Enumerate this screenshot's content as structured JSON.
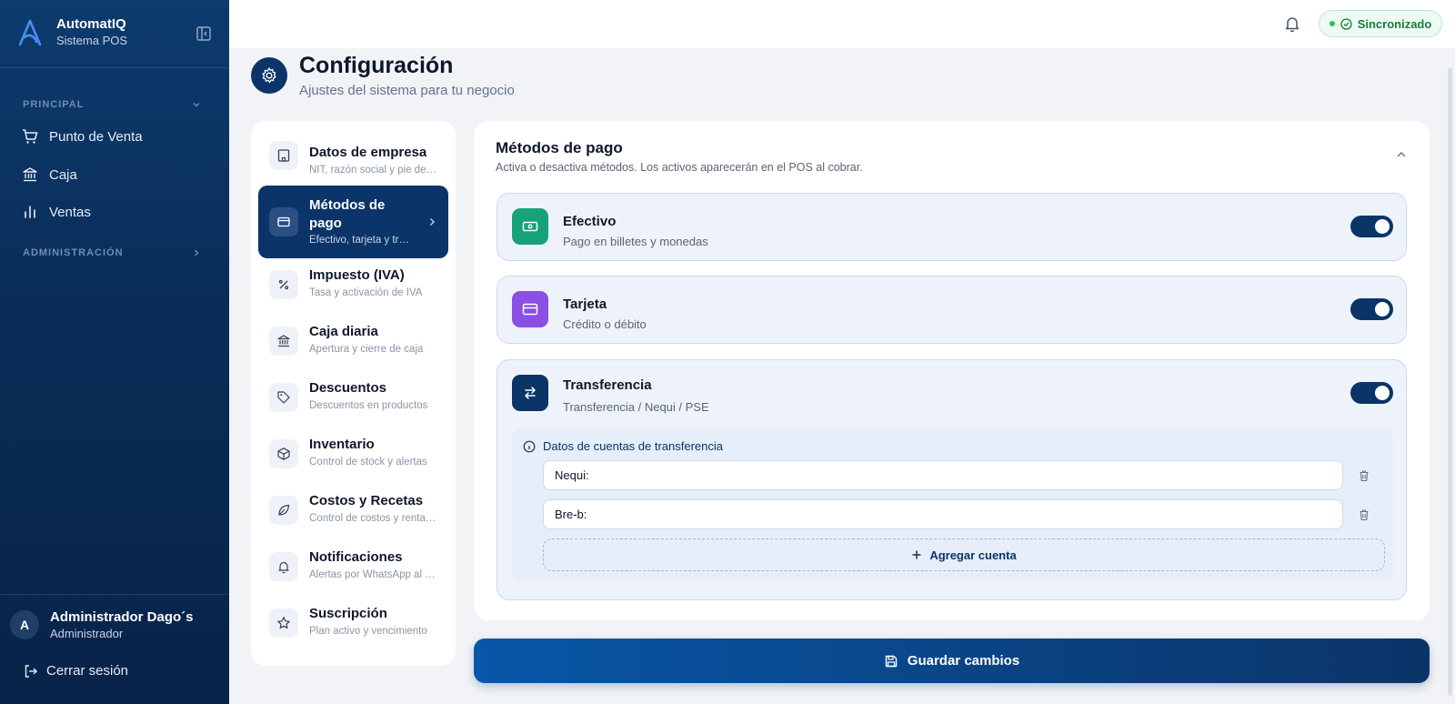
{
  "brand": {
    "name": "AutomatIQ",
    "subtitle": "Sistema POS"
  },
  "sidebar": {
    "sections": [
      {
        "label": "PRINCIPAL",
        "items": [
          {
            "label": "Punto de Venta",
            "icon": "cart-icon"
          },
          {
            "label": "Caja",
            "icon": "bank-icon"
          },
          {
            "label": "Ventas",
            "icon": "bar-chart-icon"
          }
        ]
      },
      {
        "label": "ADMINISTRACIÓN",
        "items": []
      }
    ],
    "user": {
      "initial": "A",
      "name": "Administrador Dago´s",
      "role": "Administrador"
    },
    "logout_label": "Cerrar sesión"
  },
  "topbar": {
    "status": "Sincronizado",
    "status_color": "#15803d"
  },
  "page": {
    "title": "Configuración",
    "subtitle": "Ajustes del sistema para tu negocio"
  },
  "settings_menu": [
    {
      "title": "Datos de empresa",
      "subtitle": "NIT, razón social y pie de página",
      "icon": "building-icon"
    },
    {
      "title": "Métodos de pago",
      "subtitle": "Efectivo, tarjeta y transferencia",
      "icon": "card-icon",
      "active": true
    },
    {
      "title": "Impuesto (IVA)",
      "subtitle": "Tasa y activación de IVA",
      "icon": "percent-icon"
    },
    {
      "title": "Caja diaria",
      "subtitle": "Apertura y cierre de caja",
      "icon": "bank-icon"
    },
    {
      "title": "Descuentos",
      "subtitle": "Descuentos en productos",
      "icon": "tag-icon"
    },
    {
      "title": "Inventario",
      "subtitle": "Control de stock y alertas",
      "icon": "box-icon"
    },
    {
      "title": "Costos y Recetas",
      "subtitle": "Control de costos y rentabilidad",
      "icon": "leaf-icon"
    },
    {
      "title": "Notificaciones",
      "subtitle": "Alertas por WhatsApp al cliente",
      "icon": "bell-icon"
    },
    {
      "title": "Suscripción",
      "subtitle": "Plan activo y vencimiento",
      "icon": "star-icon"
    }
  ],
  "panel": {
    "title": "Métodos de pago",
    "subtitle": "Activa o desactiva métodos. Los activos aparecerán en el POS al cobrar.",
    "methods": [
      {
        "name": "Efectivo",
        "desc": "Pago en billetes y monedas",
        "enabled": true,
        "color": "#16a37a",
        "icon": "cash-icon"
      },
      {
        "name": "Tarjeta",
        "desc": "Crédito o débito",
        "enabled": true,
        "color": "#8b4ee6",
        "icon": "card-icon"
      },
      {
        "name": "Transferencia",
        "desc": "Transferencia / Nequi / PSE",
        "enabled": true,
        "color": "#0b3468",
        "icon": "transfer-icon"
      }
    ],
    "accounts": {
      "heading": "Datos de cuentas de transferencia",
      "items": [
        {
          "value": "Nequi:"
        },
        {
          "value": "Bre-b:"
        }
      ],
      "add_label": "Agregar cuenta"
    }
  },
  "save_label": "Guardar cambios"
}
